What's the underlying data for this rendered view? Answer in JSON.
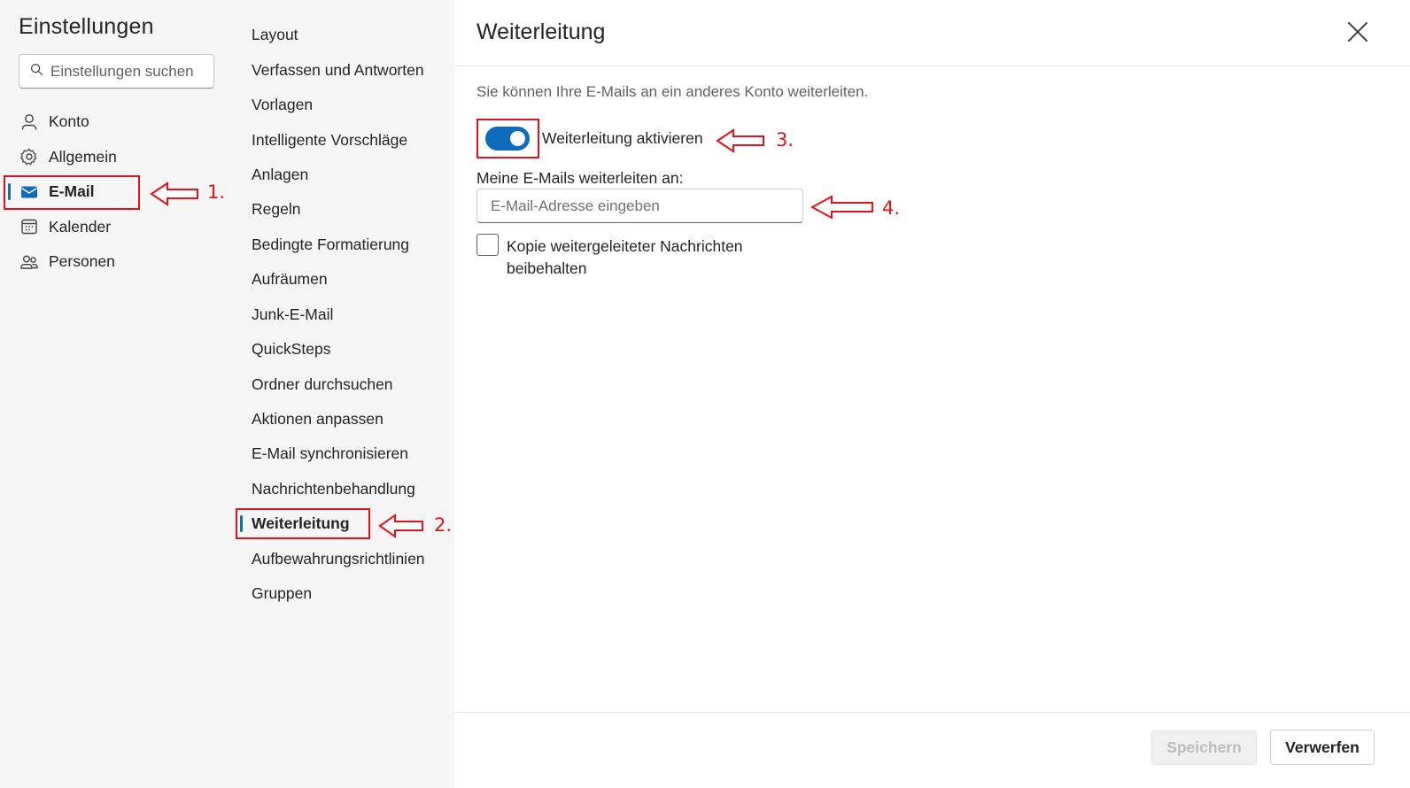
{
  "colors": {
    "accent": "#0f6cbd",
    "sidebar_bg": "#f5f5f5",
    "annotation": "#e3131b",
    "text": "#242424",
    "secondary_text": "#616161"
  },
  "sidebar": {
    "title": "Einstellungen",
    "search_placeholder": "Einstellungen suchen",
    "items": [
      {
        "label": "Konto",
        "icon": "person-icon",
        "active": false
      },
      {
        "label": "Allgemein",
        "icon": "gear-icon",
        "active": false
      },
      {
        "label": "E-Mail",
        "icon": "mail-icon",
        "active": true
      },
      {
        "label": "Kalender",
        "icon": "calendar-icon",
        "active": false
      },
      {
        "label": "Personen",
        "icon": "people-icon",
        "active": false
      }
    ]
  },
  "subnav": {
    "items": [
      {
        "label": "Layout",
        "active": false
      },
      {
        "label": "Verfassen und Antworten",
        "active": false
      },
      {
        "label": "Vorlagen",
        "active": false
      },
      {
        "label": "Intelligente Vorschläge",
        "active": false
      },
      {
        "label": "Anlagen",
        "active": false
      },
      {
        "label": "Regeln",
        "active": false
      },
      {
        "label": "Bedingte Formatierung",
        "active": false
      },
      {
        "label": "Aufräumen",
        "active": false
      },
      {
        "label": "Junk-E-Mail",
        "active": false
      },
      {
        "label": "QuickSteps",
        "active": false
      },
      {
        "label": "Ordner durchsuchen",
        "active": false
      },
      {
        "label": "Aktionen anpassen",
        "active": false
      },
      {
        "label": "E-Mail synchronisieren",
        "active": false
      },
      {
        "label": "Nachrichtenbehandlung",
        "active": false
      },
      {
        "label": "Weiterleitung",
        "active": true
      },
      {
        "label": "Aufbewahrungsrichtlinien",
        "active": false
      },
      {
        "label": "Gruppen",
        "active": false
      }
    ]
  },
  "main": {
    "title": "Weiterleitung",
    "description": "Sie können Ihre E-Mails an ein anderes Konto weiterleiten.",
    "toggle": {
      "label": "Weiterleitung aktivieren",
      "on": true
    },
    "forward_label": "Meine E-Mails weiterleiten an:",
    "forward_input": {
      "placeholder": "E-Mail-Adresse eingeben",
      "value": ""
    },
    "checkbox": {
      "label": "Kopie weitergeleiteter Nachrichten beibehalten",
      "checked": false
    },
    "buttons": {
      "save": "Speichern",
      "discard": "Verwerfen"
    }
  },
  "annotations": [
    {
      "number": "1."
    },
    {
      "number": "2."
    },
    {
      "number": "3."
    },
    {
      "number": "4."
    }
  ]
}
